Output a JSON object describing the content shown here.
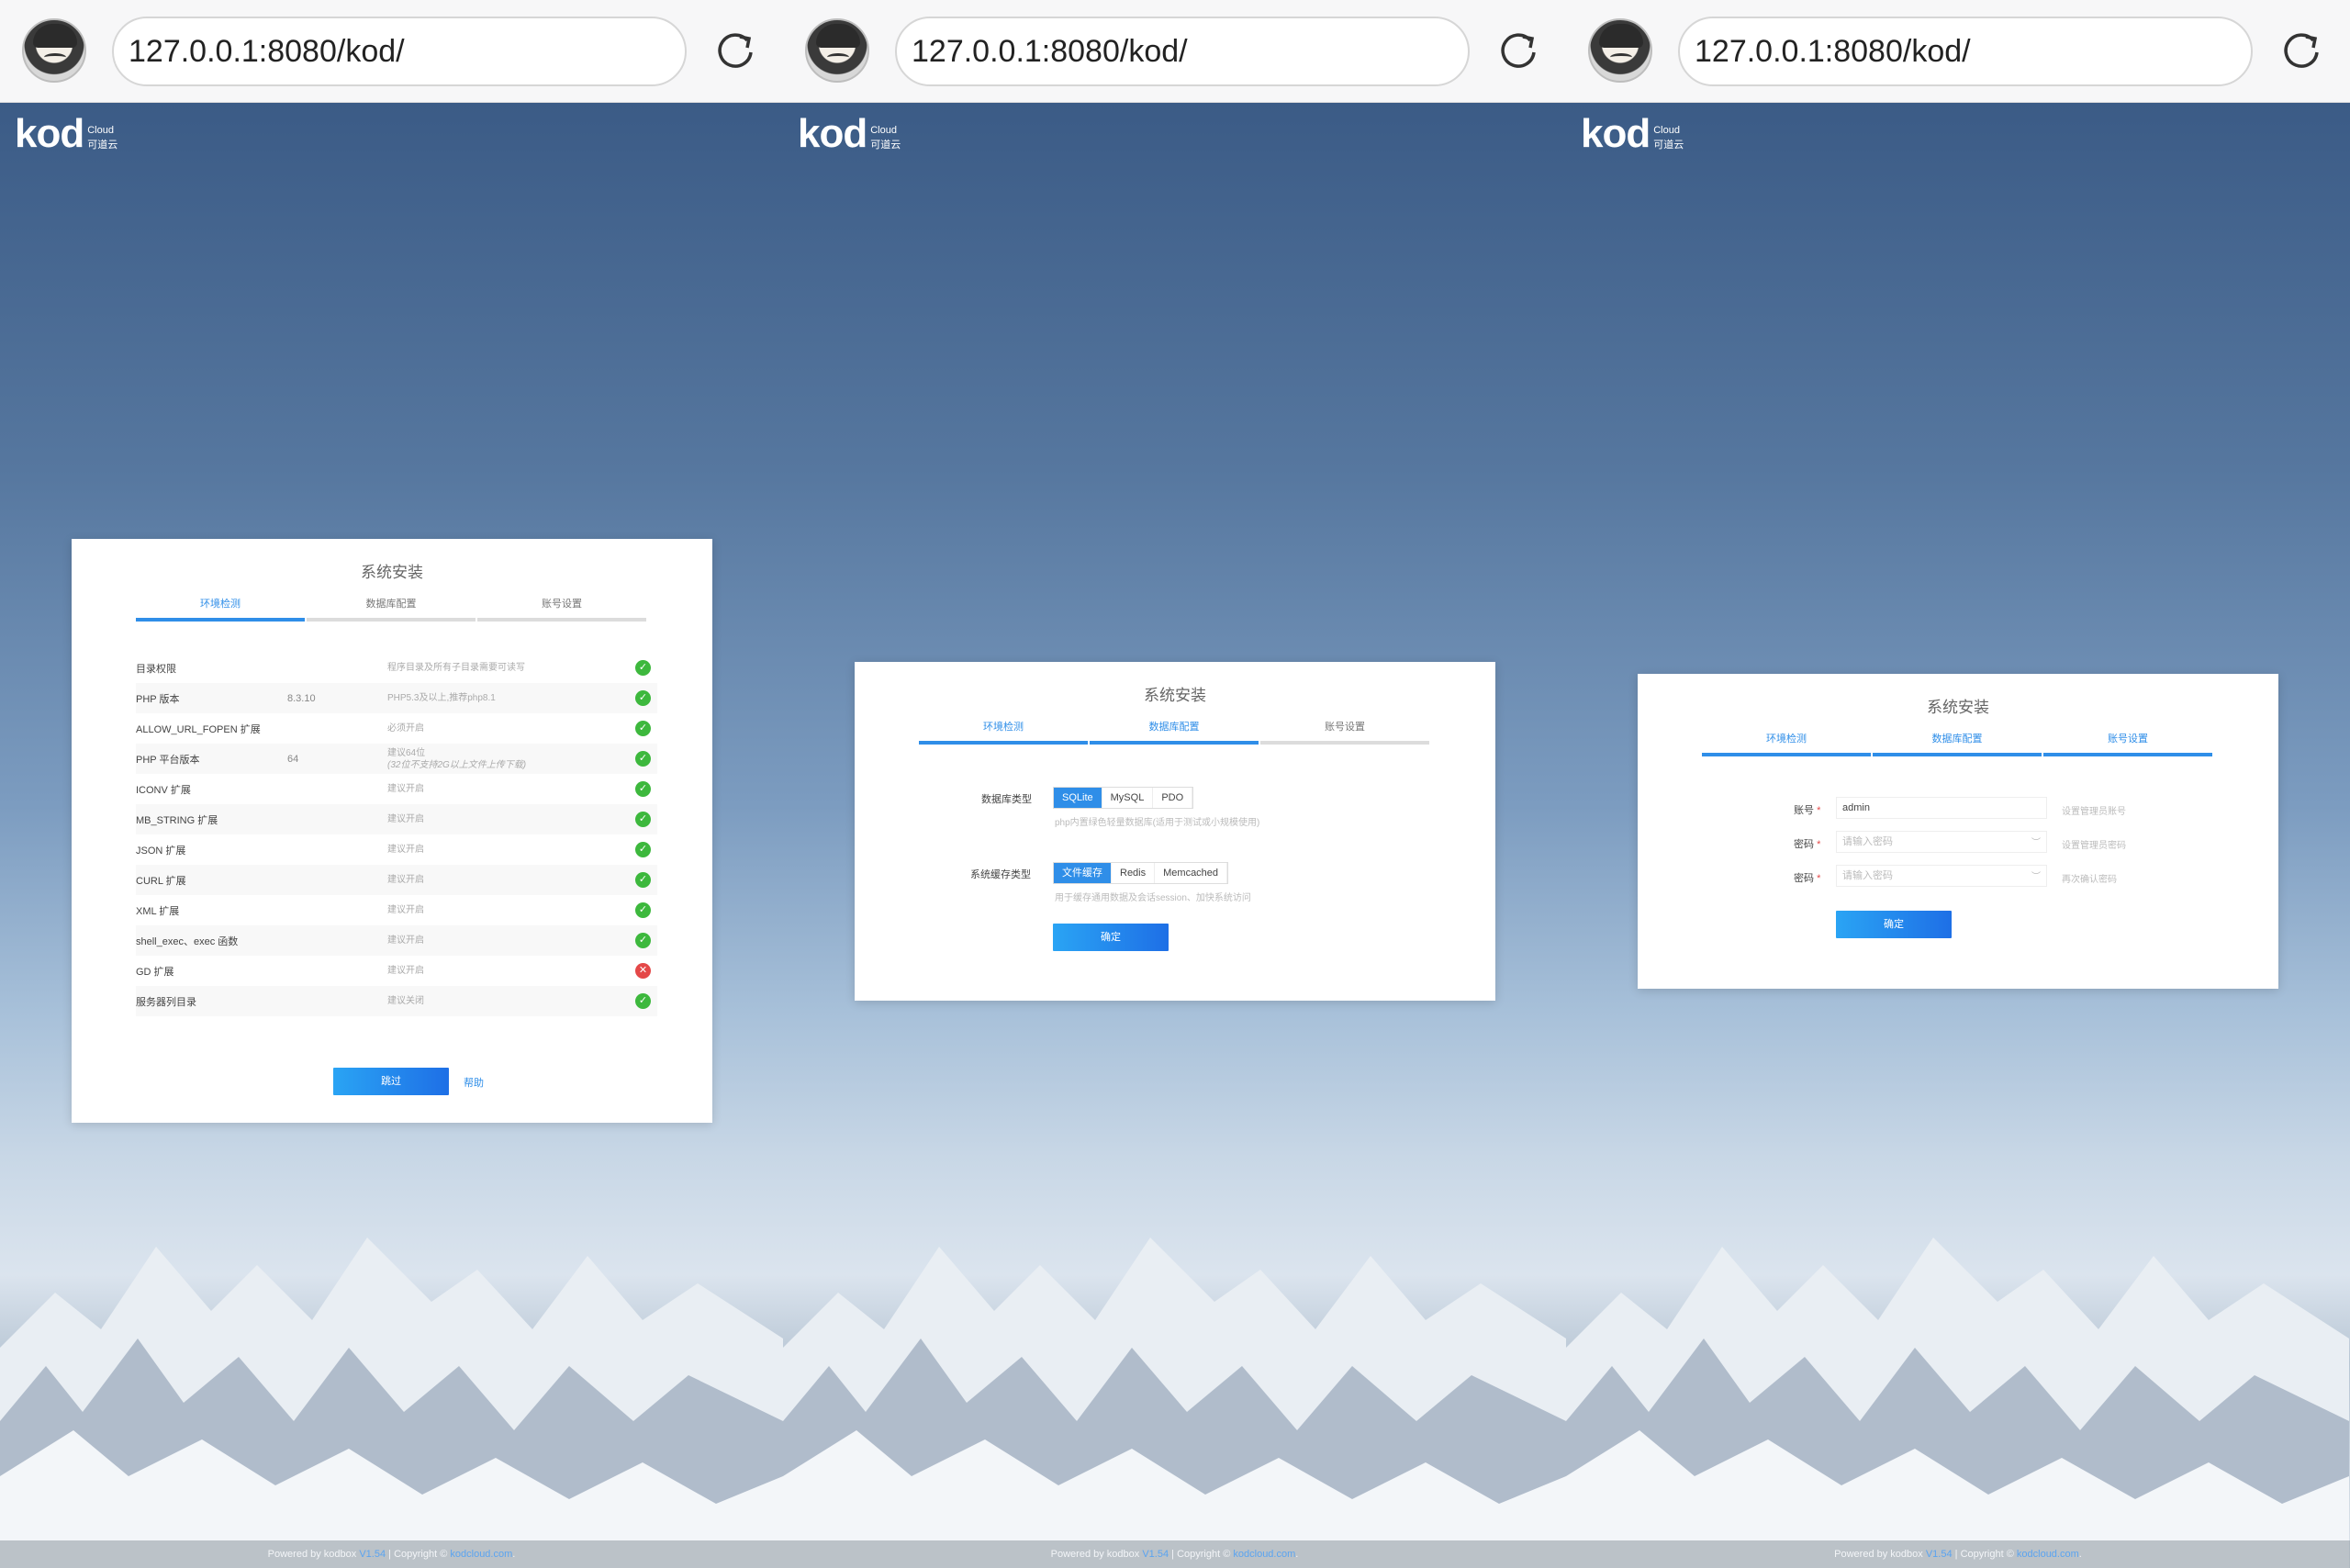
{
  "browser": {
    "url": "127.0.0.1:8080/kod/"
  },
  "logo": {
    "brand": "kod",
    "cloud": "Cloud",
    "cn": "可道云"
  },
  "footer": {
    "powered": "Powered by kodbox",
    "version": "V1.54",
    "sep": "|",
    "copyright": "Copyright ©",
    "site": "kodcloud.com",
    "end": "."
  },
  "install": {
    "title": "系统安装",
    "steps": [
      "环境检测",
      "数据库配置",
      "账号设置"
    ]
  },
  "env": {
    "rows": [
      {
        "name": "目录权限",
        "value": "",
        "note": "程序目录及所有子目录需要可读写",
        "ok": true
      },
      {
        "name": "PHP 版本",
        "value": "8.3.10",
        "note": "PHP5.3及以上,推荐php8.1",
        "ok": true
      },
      {
        "name": "ALLOW_URL_FOPEN 扩展",
        "value": "",
        "note": "必须开启",
        "ok": true
      },
      {
        "name": "PHP 平台版本",
        "value": "64",
        "note": "建议64位",
        "note2": "(32位不支持2G以上文件上传下载)",
        "ok": true
      },
      {
        "name": "ICONV 扩展",
        "value": "",
        "note": "建议开启",
        "ok": true
      },
      {
        "name": "MB_STRING 扩展",
        "value": "",
        "note": "建议开启",
        "ok": true
      },
      {
        "name": "JSON 扩展",
        "value": "",
        "note": "建议开启",
        "ok": true
      },
      {
        "name": "CURL 扩展",
        "value": "",
        "note": "建议开启",
        "ok": true
      },
      {
        "name": "XML 扩展",
        "value": "",
        "note": "建议开启",
        "ok": true
      },
      {
        "name": "shell_exec、exec 函数",
        "value": "",
        "note": "建议开启",
        "ok": true
      },
      {
        "name": "GD 扩展",
        "value": "",
        "note": "建议开启",
        "ok": false
      },
      {
        "name": "服务器列目录",
        "value": "",
        "note": "建议关闭",
        "ok": true
      }
    ],
    "next_label": "跳过",
    "help_label": "帮助"
  },
  "db": {
    "db_type_label": "数据库类型",
    "db_types": [
      "SQLite",
      "MySQL",
      "PDO"
    ],
    "db_selected": "SQLite",
    "db_hint": "php内置绿色轻量数据库(适用于测试或小规模使用)",
    "cache_label": "系统缓存类型",
    "cache_types": [
      "文件缓存",
      "Redis",
      "Memcached"
    ],
    "cache_selected": "文件缓存",
    "cache_hint": "用于缓存通用数据及会话session、加快系统访问",
    "ok_label": "确定"
  },
  "account": {
    "user_label": "账号",
    "user_value": "admin",
    "user_hint": "设置管理员账号",
    "pwd_label": "密码",
    "pwd_placeholder": "请输入密码",
    "pwd_hint": "设置管理员密码",
    "pwd2_label": "密码",
    "pwd2_placeholder": "请输入密码",
    "pwd2_hint": "再次确认密码",
    "ok_label": "确定"
  },
  "colors": {
    "accent": "#2f8ee8",
    "ok": "#3db83d",
    "fail": "#e44848"
  }
}
